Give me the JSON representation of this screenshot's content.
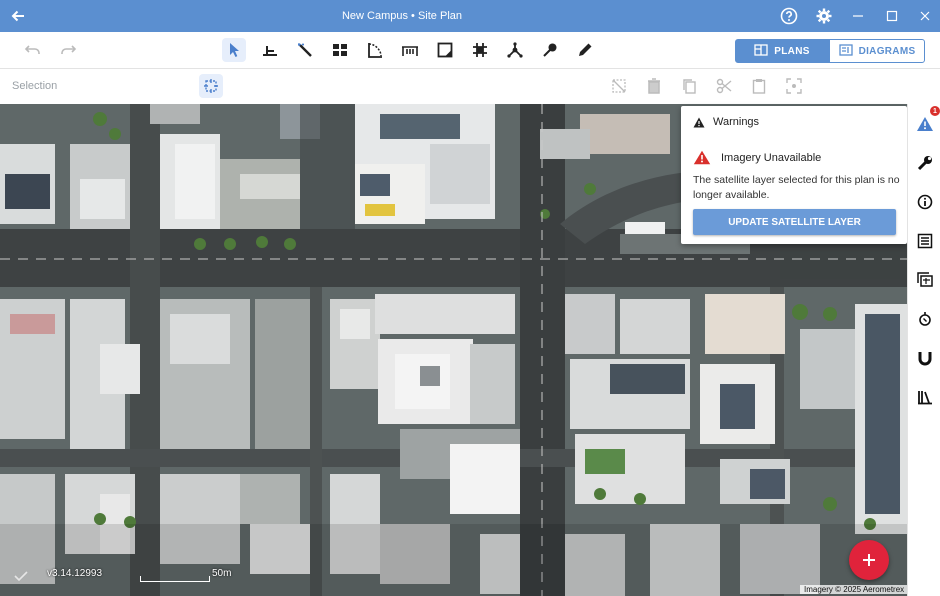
{
  "window": {
    "title": "New Campus • Site Plan",
    "title_bar_color": "#5b8fd0"
  },
  "toolbar": {
    "undo_icon": "undo-icon",
    "redo_icon": "redo-icon",
    "tools": [
      "select-arrow-icon",
      "level-tool-icon",
      "wand-tool-icon",
      "grid-tool-icon",
      "curve-tool-icon",
      "measure-tool-icon",
      "shape-tool-icon",
      "hash-tool-icon",
      "network-tool-icon",
      "marker-tool-icon",
      "pencil-icon"
    ],
    "plans_label": "PLANS",
    "diagrams_label": "DIAGRAMS"
  },
  "selection_bar": {
    "label": "Selection"
  },
  "warnings_panel": {
    "header": "Warnings",
    "issue_title": "Imagery Unavailable",
    "message": "The satellite layer selected for this plan is no longer available.",
    "button_label": "UPDATE SATELLITE LAYER",
    "warning_color": "#d9302c"
  },
  "right_sidebar": {
    "badge_count": "1",
    "items": [
      "warning-icon",
      "wrench-icon",
      "info-icon",
      "list-icon",
      "layers-icon",
      "sun-icon",
      "magnet-icon",
      "library-icon"
    ]
  },
  "map": {
    "version": "v3.14.12993",
    "scale_label": "50m",
    "credit": "Imagery © 2025 Aerometrex"
  },
  "accent_color": "#5b8fd0",
  "fab_color": "#e0233b"
}
